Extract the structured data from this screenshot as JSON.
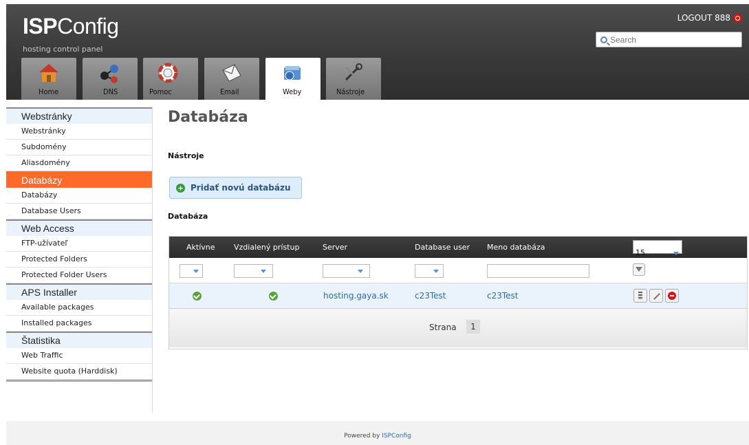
{
  "header": {
    "logo_bold": "ISP",
    "logo_rest": "Config",
    "subtitle": "hosting control panel",
    "logout": "LOGOUT 888",
    "search_placeholder": "Search"
  },
  "tabs": [
    {
      "label": "Home"
    },
    {
      "label": "DNS"
    },
    {
      "label": "Pomoc"
    },
    {
      "label": "Email"
    },
    {
      "label": "Weby"
    },
    {
      "label": "Nástroje"
    }
  ],
  "sidebar": {
    "sections": [
      {
        "title": "Webstránky",
        "items": [
          "Webstránky",
          "Subdomény",
          "Aliasdomény"
        ]
      },
      {
        "title": "Databázy",
        "items": [
          "Databázy",
          "Database Users"
        ]
      },
      {
        "title": "Web Access",
        "items": [
          "FTP-užívateľ",
          "Protected Folders",
          "Protected Folder Users"
        ]
      },
      {
        "title": "APS Installer",
        "items": [
          "Available packages",
          "Installed packages"
        ]
      },
      {
        "title": "Štatistika",
        "items": [
          "Web Traffic",
          "Website quota (Harddisk)"
        ]
      }
    ]
  },
  "main": {
    "title": "Databáza",
    "tools_label": "Nástroje",
    "add_button": "Pridať novú databázu",
    "list_label": "Databáza",
    "columns": [
      "Aktívne",
      "Vzdialený prístup",
      "Server",
      "Database user",
      "Meno databáza"
    ],
    "per_page": "15",
    "rows": [
      {
        "server": "hosting.gaya.sk",
        "db_user": "c23Test",
        "db_name": "c23Test"
      }
    ],
    "page_label": "Strana",
    "page_number": "1"
  },
  "footer": {
    "text": "Powered by",
    "brand": "ISPConfig"
  },
  "colors": {
    "accent": "#ff6a2b",
    "link": "#2a6ab8",
    "header": "#3c3c3c"
  }
}
